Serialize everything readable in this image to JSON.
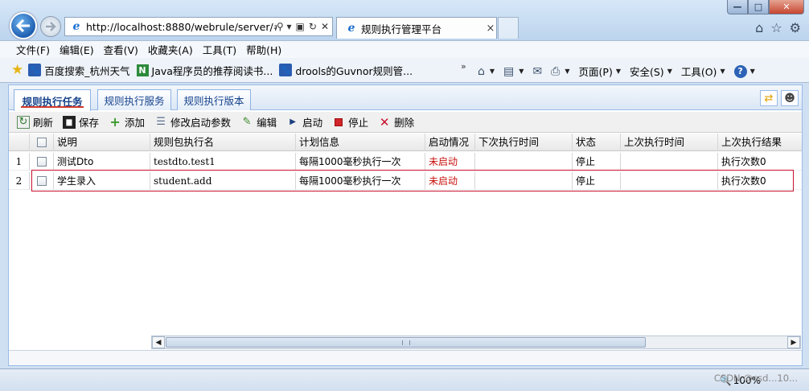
{
  "browser": {
    "url": "http://localhost:8880/webrule/server/#",
    "tab_title": "规则执行管理平台",
    "tab_close": "×",
    "addr_tools": [
      "⚲ ▾",
      "▣",
      "↻",
      "✕"
    ],
    "window_controls": {
      "minimize": "—",
      "maximize": "□",
      "close": "✕"
    },
    "right_icons": [
      "⌂",
      "☆",
      "⚙"
    ]
  },
  "menu": [
    "文件(F)",
    "编辑(E)",
    "查看(V)",
    "收藏夹(A)",
    "工具(T)",
    "帮助(H)"
  ],
  "favorites": [
    {
      "icon": "baidu-icon",
      "label": "百度搜索_杭州天气"
    },
    {
      "icon": "n-icon",
      "label": "Java程序员的推荐阅读书..."
    },
    {
      "icon": "baidu-icon",
      "label": "drools的Guvnor规则管..."
    }
  ],
  "command_bar": {
    "chevron": "»",
    "page": "页面(P)",
    "safety": "安全(S)",
    "tools": "工具(O)"
  },
  "app": {
    "tabs": [
      "规则执行任务",
      "规则执行服务",
      "规则执行版本"
    ],
    "toolbar": {
      "refresh": "刷新",
      "save": "保存",
      "add": "添加",
      "modify_params": "修改启动参数",
      "edit": "编辑",
      "start": "启动",
      "stop": "停止",
      "delete": "删除"
    },
    "grid": {
      "columns": [
        "说明",
        "规则包执行名",
        "计划信息",
        "启动情况",
        "下次执行时间",
        "状态",
        "上次执行时间",
        "上次执行结果"
      ],
      "rows": [
        {
          "num": "1",
          "desc": "测试Dto",
          "pkg": "testdto.test1",
          "plan": "每隔1000毫秒执行一次",
          "launch": "未启动",
          "next": "",
          "status": "停止",
          "last_time": "",
          "last_result": "执行次数0"
        },
        {
          "num": "2",
          "desc": "学生录入",
          "pkg": "student.add",
          "plan": "每隔1000毫秒执行一次",
          "launch": "未启动",
          "next": "",
          "status": "停止",
          "last_time": "",
          "last_result": "执行次数0"
        }
      ]
    }
  },
  "status": {
    "zoom": "100%",
    "watermark": "CSDN @csd...10..."
  },
  "colors": {
    "accent": "#15428b",
    "error_red": "#c8100c",
    "selection_outline": "#c8102e"
  }
}
